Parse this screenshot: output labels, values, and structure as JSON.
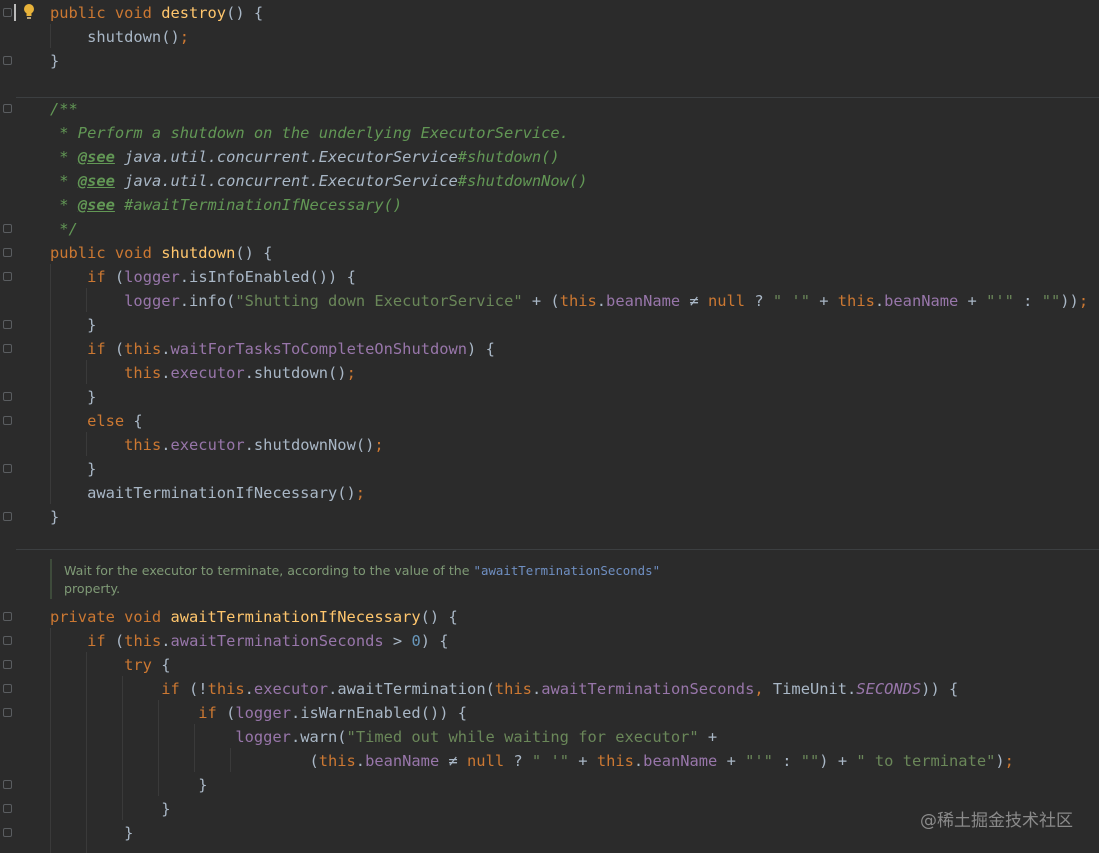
{
  "lines": [
    {
      "id": "L1",
      "tokens": [
        {
          "t": "public void ",
          "c": "kw"
        },
        {
          "t": "destroy",
          "c": "fn"
        },
        {
          "t": "() {",
          "c": ""
        }
      ]
    },
    {
      "id": "L2",
      "tokens": [
        {
          "t": "    shutdown()",
          "c": ""
        },
        {
          "t": ";",
          "c": "kw"
        }
      ]
    },
    {
      "id": "L3",
      "tokens": [
        {
          "t": "}",
          "c": ""
        }
      ]
    },
    {
      "id": "L4",
      "tokens": [
        {
          "t": "/**",
          "c": "cm"
        }
      ]
    },
    {
      "id": "L5",
      "tokens": [
        {
          "t": " * Perform a shutdown on the underlying ExecutorService.",
          "c": "cm"
        }
      ]
    },
    {
      "id": "L6",
      "tokens": [
        {
          "t": " * ",
          "c": "cm"
        },
        {
          "t": "@see",
          "c": "tag"
        },
        {
          "t": " ",
          "c": "cm"
        },
        {
          "t": "java.util.concurrent.ExecutorService",
          "c": "ital"
        },
        {
          "t": "#shutdown()",
          "c": "cm"
        }
      ]
    },
    {
      "id": "L7",
      "tokens": [
        {
          "t": " * ",
          "c": "cm"
        },
        {
          "t": "@see",
          "c": "tag"
        },
        {
          "t": " ",
          "c": "cm"
        },
        {
          "t": "java.util.concurrent.ExecutorService",
          "c": "ital"
        },
        {
          "t": "#shutdownNow()",
          "c": "cm"
        }
      ]
    },
    {
      "id": "L8",
      "tokens": [
        {
          "t": " * ",
          "c": "cm"
        },
        {
          "t": "@see",
          "c": "tag"
        },
        {
          "t": " #awaitTerminationIfNecessary()",
          "c": "cm"
        }
      ]
    },
    {
      "id": "L9",
      "tokens": [
        {
          "t": " */",
          "c": "cm"
        }
      ]
    },
    {
      "id": "L10",
      "tokens": [
        {
          "t": "public void ",
          "c": "kw"
        },
        {
          "t": "shutdown",
          "c": "fn"
        },
        {
          "t": "() {",
          "c": ""
        }
      ]
    },
    {
      "id": "L11",
      "tokens": [
        {
          "t": "    ",
          "c": ""
        },
        {
          "t": "if ",
          "c": "kw"
        },
        {
          "t": "(",
          "c": ""
        },
        {
          "t": "logger",
          "c": "fld"
        },
        {
          "t": ".isInfoEnabled()) {",
          "c": ""
        }
      ]
    },
    {
      "id": "L12",
      "tokens": [
        {
          "t": "        ",
          "c": ""
        },
        {
          "t": "logger",
          "c": "fld"
        },
        {
          "t": ".info(",
          "c": ""
        },
        {
          "t": "\"Shutting down ExecutorService\"",
          "c": "str"
        },
        {
          "t": " + (",
          "c": ""
        },
        {
          "t": "this",
          "c": "kw"
        },
        {
          "t": ".",
          "c": ""
        },
        {
          "t": "beanName",
          "c": "fld"
        },
        {
          "t": " ≠ ",
          "c": ""
        },
        {
          "t": "null",
          "c": "kw"
        },
        {
          "t": " ? ",
          "c": ""
        },
        {
          "t": "\" '\"",
          "c": "str"
        },
        {
          "t": " + ",
          "c": ""
        },
        {
          "t": "this",
          "c": "kw"
        },
        {
          "t": ".",
          "c": ""
        },
        {
          "t": "beanName",
          "c": "fld"
        },
        {
          "t": " + ",
          "c": ""
        },
        {
          "t": "\"'\"",
          "c": "str"
        },
        {
          "t": " : ",
          "c": ""
        },
        {
          "t": "\"\"",
          "c": "str"
        },
        {
          "t": "))",
          "c": ""
        },
        {
          "t": ";",
          "c": "kw"
        }
      ]
    },
    {
      "id": "L13",
      "tokens": [
        {
          "t": "    }",
          "c": ""
        }
      ]
    },
    {
      "id": "L14",
      "tokens": [
        {
          "t": "    ",
          "c": ""
        },
        {
          "t": "if ",
          "c": "kw"
        },
        {
          "t": "(",
          "c": ""
        },
        {
          "t": "this",
          "c": "kw"
        },
        {
          "t": ".",
          "c": ""
        },
        {
          "t": "waitForTasksToCompleteOnShutdown",
          "c": "fld"
        },
        {
          "t": ") {",
          "c": ""
        }
      ]
    },
    {
      "id": "L15",
      "tokens": [
        {
          "t": "        ",
          "c": ""
        },
        {
          "t": "this",
          "c": "kw"
        },
        {
          "t": ".",
          "c": ""
        },
        {
          "t": "executor",
          "c": "fld"
        },
        {
          "t": ".shutdown()",
          "c": ""
        },
        {
          "t": ";",
          "c": "kw"
        }
      ]
    },
    {
      "id": "L16",
      "tokens": [
        {
          "t": "    }",
          "c": ""
        }
      ]
    },
    {
      "id": "L17",
      "tokens": [
        {
          "t": "    ",
          "c": ""
        },
        {
          "t": "else ",
          "c": "kw"
        },
        {
          "t": "{",
          "c": ""
        }
      ]
    },
    {
      "id": "L18",
      "tokens": [
        {
          "t": "        ",
          "c": ""
        },
        {
          "t": "this",
          "c": "kw"
        },
        {
          "t": ".",
          "c": ""
        },
        {
          "t": "executor",
          "c": "fld"
        },
        {
          "t": ".shutdownNow()",
          "c": ""
        },
        {
          "t": ";",
          "c": "kw"
        }
      ]
    },
    {
      "id": "L19",
      "tokens": [
        {
          "t": "    }",
          "c": ""
        }
      ]
    },
    {
      "id": "L20",
      "tokens": [
        {
          "t": "    awaitTerminationIfNecessary()",
          "c": ""
        },
        {
          "t": ";",
          "c": "kw"
        }
      ]
    },
    {
      "id": "L21",
      "tokens": [
        {
          "t": "}",
          "c": ""
        }
      ]
    },
    {
      "id": "L22",
      "tokens": [
        {
          "t": "private void ",
          "c": "kw"
        },
        {
          "t": "awaitTerminationIfNecessary",
          "c": "fn"
        },
        {
          "t": "() {",
          "c": ""
        }
      ]
    },
    {
      "id": "L23",
      "tokens": [
        {
          "t": "    ",
          "c": ""
        },
        {
          "t": "if ",
          "c": "kw"
        },
        {
          "t": "(",
          "c": ""
        },
        {
          "t": "this",
          "c": "kw"
        },
        {
          "t": ".",
          "c": ""
        },
        {
          "t": "awaitTerminationSeconds",
          "c": "fld"
        },
        {
          "t": " > ",
          "c": ""
        },
        {
          "t": "0",
          "c": "num"
        },
        {
          "t": ") {",
          "c": ""
        }
      ]
    },
    {
      "id": "L24",
      "tokens": [
        {
          "t": "        ",
          "c": ""
        },
        {
          "t": "try ",
          "c": "kw"
        },
        {
          "t": "{",
          "c": ""
        }
      ]
    },
    {
      "id": "L25",
      "tokens": [
        {
          "t": "            ",
          "c": ""
        },
        {
          "t": "if ",
          "c": "kw"
        },
        {
          "t": "(!",
          "c": ""
        },
        {
          "t": "this",
          "c": "kw"
        },
        {
          "t": ".",
          "c": ""
        },
        {
          "t": "executor",
          "c": "fld"
        },
        {
          "t": ".awaitTermination(",
          "c": ""
        },
        {
          "t": "this",
          "c": "kw"
        },
        {
          "t": ".",
          "c": ""
        },
        {
          "t": "awaitTerminationSeconds",
          "c": "fld"
        },
        {
          "t": ", ",
          "c": "kw"
        },
        {
          "t": "TimeUnit.",
          "c": ""
        },
        {
          "t": "SECONDS",
          "c": "fld ital"
        },
        {
          "t": ")) {",
          "c": ""
        }
      ]
    },
    {
      "id": "L26",
      "tokens": [
        {
          "t": "                ",
          "c": ""
        },
        {
          "t": "if ",
          "c": "kw"
        },
        {
          "t": "(",
          "c": ""
        },
        {
          "t": "logger",
          "c": "fld"
        },
        {
          "t": ".isWarnEnabled()) {",
          "c": ""
        }
      ]
    },
    {
      "id": "L27",
      "tokens": [
        {
          "t": "                    ",
          "c": ""
        },
        {
          "t": "logger",
          "c": "fld"
        },
        {
          "t": ".warn(",
          "c": ""
        },
        {
          "t": "\"Timed out while waiting for executor\"",
          "c": "str"
        },
        {
          "t": " +",
          "c": ""
        }
      ]
    },
    {
      "id": "L28",
      "tokens": [
        {
          "t": "                            (",
          "c": ""
        },
        {
          "t": "this",
          "c": "kw"
        },
        {
          "t": ".",
          "c": ""
        },
        {
          "t": "beanName",
          "c": "fld"
        },
        {
          "t": " ≠ ",
          "c": ""
        },
        {
          "t": "null",
          "c": "kw"
        },
        {
          "t": " ? ",
          "c": ""
        },
        {
          "t": "\" '\"",
          "c": "str"
        },
        {
          "t": " + ",
          "c": ""
        },
        {
          "t": "this",
          "c": "kw"
        },
        {
          "t": ".",
          "c": ""
        },
        {
          "t": "beanName",
          "c": "fld"
        },
        {
          "t": " + ",
          "c": ""
        },
        {
          "t": "\"'\"",
          "c": "str"
        },
        {
          "t": " : ",
          "c": ""
        },
        {
          "t": "\"\"",
          "c": "str"
        },
        {
          "t": ") + ",
          "c": ""
        },
        {
          "t": "\" to terminate\"",
          "c": "str"
        },
        {
          "t": ")",
          "c": ""
        },
        {
          "t": ";",
          "c": "kw"
        }
      ]
    },
    {
      "id": "L29",
      "tokens": [
        {
          "t": "                }",
          "c": ""
        }
      ]
    },
    {
      "id": "L30",
      "tokens": [
        {
          "t": "            }",
          "c": ""
        }
      ]
    },
    {
      "id": "L31",
      "tokens": [
        {
          "t": "        }",
          "c": ""
        }
      ]
    }
  ],
  "doc_popup": {
    "text_before": "Wait for the executor to terminate, according to the value of the ",
    "code": "\"awaitTerminationSeconds\"",
    "text_after": "property."
  },
  "watermark": "@稀土掘金技术社区",
  "icons": {
    "intention_bulb": "lightbulb-icon",
    "fold_markers": "fold-icon"
  },
  "colors": {
    "background": "#2b2b2b",
    "keyword": "#cc7832",
    "method": "#ffc66d",
    "field": "#9876aa",
    "string": "#6a8759",
    "comment": "#629755",
    "number": "#6897bb",
    "text": "#a9b7c6"
  }
}
